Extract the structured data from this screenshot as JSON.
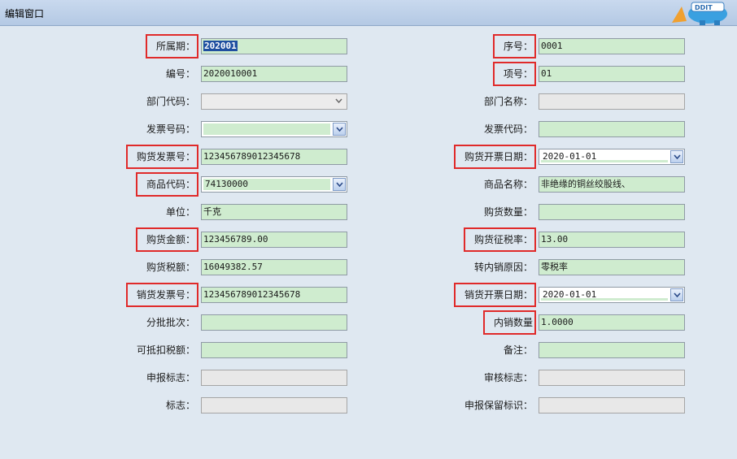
{
  "window": {
    "title": "编辑窗口",
    "logo_text": "DDIT"
  },
  "left": [
    {
      "label": "所属期：",
      "value": "202001",
      "type": "text",
      "selected": true,
      "hl": true
    },
    {
      "label": "编号：",
      "value": "2020010001",
      "type": "text"
    },
    {
      "label": "部门代码：",
      "value": "",
      "type": "combo-plain"
    },
    {
      "label": "发票号码：",
      "value": "",
      "type": "combo"
    },
    {
      "label": "购货发票号：",
      "value": "123456789012345678",
      "type": "text",
      "hl": true
    },
    {
      "label": "商品代码：",
      "value": "74130000",
      "type": "combo",
      "hl": true
    },
    {
      "label": "单位：",
      "value": "千克",
      "type": "text"
    },
    {
      "label": "购货金额：",
      "value": "123456789.00",
      "type": "text",
      "hl": true
    },
    {
      "label": "购货税额：",
      "value": "16049382.57",
      "type": "text"
    },
    {
      "label": "销货发票号：",
      "value": "123456789012345678",
      "type": "text",
      "hl": true
    },
    {
      "label": "分批批次：",
      "value": "",
      "type": "text"
    },
    {
      "label": "可抵扣税额：",
      "value": "",
      "type": "text"
    },
    {
      "label": "申报标志：",
      "value": "",
      "type": "gray"
    },
    {
      "label": "标志：",
      "value": "",
      "type": "gray"
    }
  ],
  "right": [
    {
      "label": "序号：",
      "value": "0001",
      "type": "text",
      "hl": true
    },
    {
      "label": "项号：",
      "value": "01",
      "type": "text",
      "hl": true
    },
    {
      "label": "部门名称：",
      "value": "",
      "type": "gray"
    },
    {
      "label": "发票代码：",
      "value": "",
      "type": "text"
    },
    {
      "label": "购货开票日期：",
      "value": "2020-01-01",
      "type": "date",
      "hl": true
    },
    {
      "label": "商品名称：",
      "value": "非绝缘的铜丝绞股线、",
      "type": "text"
    },
    {
      "label": "购货数量：",
      "value": "",
      "type": "text"
    },
    {
      "label": "购货征税率：",
      "value": "13.00",
      "type": "text",
      "hl": true
    },
    {
      "label": "转内销原因：",
      "value": "零税率",
      "type": "text"
    },
    {
      "label": "销货开票日期：",
      "value": "2020-01-01",
      "type": "date",
      "hl": true
    },
    {
      "label": "内销数量",
      "value": "1.0000",
      "type": "text",
      "hl": true
    },
    {
      "label": "备注：",
      "value": "",
      "type": "text"
    },
    {
      "label": "审核标志：",
      "value": "",
      "type": "gray"
    },
    {
      "label": "申报保留标识：",
      "value": "",
      "type": "gray"
    }
  ],
  "colors": {
    "field_green": "#cfeccf",
    "highlight_red": "#e02a2a",
    "background": "#dfe8f1"
  }
}
